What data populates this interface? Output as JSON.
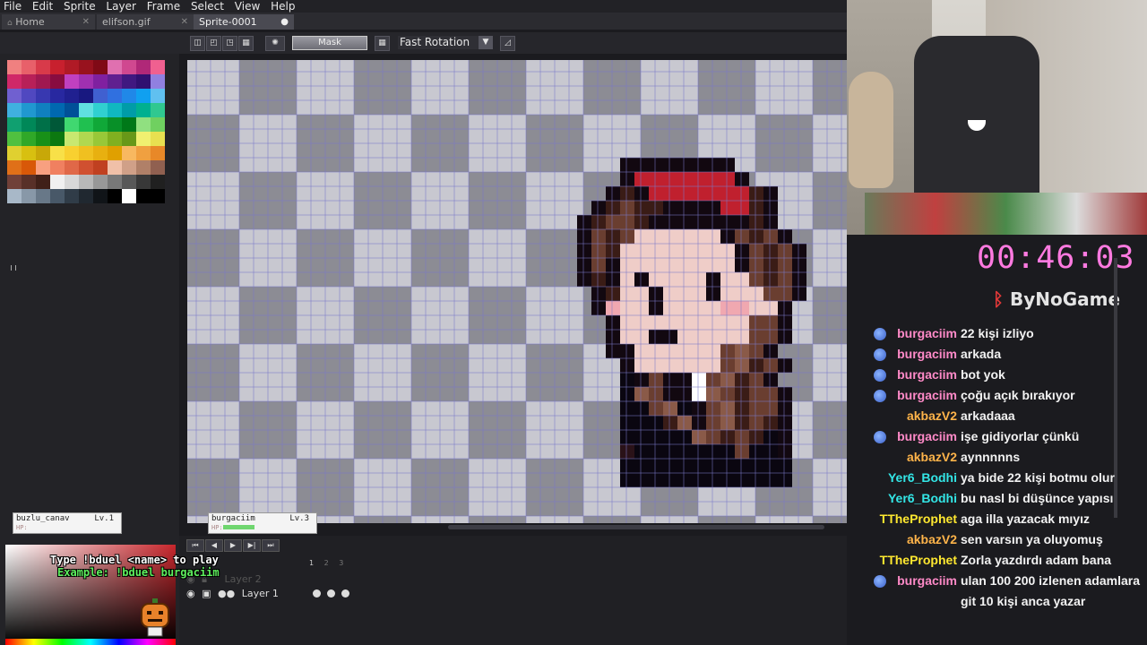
{
  "menu": [
    "File",
    "Edit",
    "Sprite",
    "Layer",
    "Frame",
    "Select",
    "View",
    "Help"
  ],
  "tabs": [
    {
      "label": "Home"
    },
    {
      "label": "elifson.gif"
    },
    {
      "label": "Sprite-0001"
    }
  ],
  "toolbar": {
    "mask_label": "Mask",
    "rotation": "Fast Rotation"
  },
  "players": [
    {
      "name": "buzlu_canav",
      "level": "Lv.1",
      "hp_label": "HP:",
      "hp": 0
    },
    {
      "name": "burgaciim",
      "level": "Lv.3",
      "hp_label": "HP:",
      "hp": 0.35
    }
  ],
  "duel": {
    "line1": "Type !bduel <name> to play",
    "line2": "Example: !bduel burgaciim"
  },
  "layers": [
    {
      "name": "Layer 2"
    },
    {
      "name": "Layer 1"
    }
  ],
  "frames": [
    "1",
    "2",
    "3"
  ],
  "timer": "00:46:03",
  "brand": "ByNoGame",
  "colors": {
    "accent_pink": "#ff7ae0",
    "user_pink": "#ff8ac8",
    "user_orange": "#ffb44a",
    "user_cyan": "#33e6e6",
    "user_yellow": "#ffe830"
  },
  "chat": [
    {
      "user": "burgaciim",
      "text": "22 kişi izliyo",
      "color": "#ff8ac8",
      "badge": true
    },
    {
      "user": "burgaciim",
      "text": "arkada",
      "color": "#ff8ac8",
      "badge": true
    },
    {
      "user": "burgaciim",
      "text": "bot yok",
      "color": "#ff8ac8",
      "badge": true
    },
    {
      "user": "burgaciim",
      "text": "çoğu açık bırakıyor",
      "color": "#ff8ac8",
      "badge": true
    },
    {
      "user": "akbazV2",
      "text": "arkadaaa",
      "color": "#ffb44a",
      "badge": false
    },
    {
      "user": "burgaciim",
      "text": "işe gidiyorlar çünkü",
      "color": "#ff8ac8",
      "badge": true
    },
    {
      "user": "akbazV2",
      "text": "aynnnnns",
      "color": "#ffb44a",
      "badge": false
    },
    {
      "user": "Yer6_Bodhi",
      "text": "ya bide 22 kişi botmu olur",
      "color": "#33e6e6",
      "badge": false
    },
    {
      "user": "Yer6_Bodhi",
      "text": "bu nasl bi düşünce yapısı",
      "color": "#33e6e6",
      "badge": false
    },
    {
      "user": "TTheProphet",
      "text": "aga illa yazacak mıyız",
      "color": "#ffe830",
      "badge": false
    },
    {
      "user": "akbazV2",
      "text": "sen varsın ya oluyomuş",
      "color": "#ffb44a",
      "badge": false
    },
    {
      "user": "TTheProphet",
      "text": "Zorla yazdırdı adam bana",
      "color": "#ffe830",
      "badge": false
    },
    {
      "user": "burgaciim",
      "text": "ulan 100 200 izlenen adamlara",
      "color": "#ff8ac8",
      "badge": true
    },
    {
      "user": "",
      "text": "git 10 kişi anca yazar",
      "color": "#ff8ac8",
      "badge": false
    }
  ]
}
